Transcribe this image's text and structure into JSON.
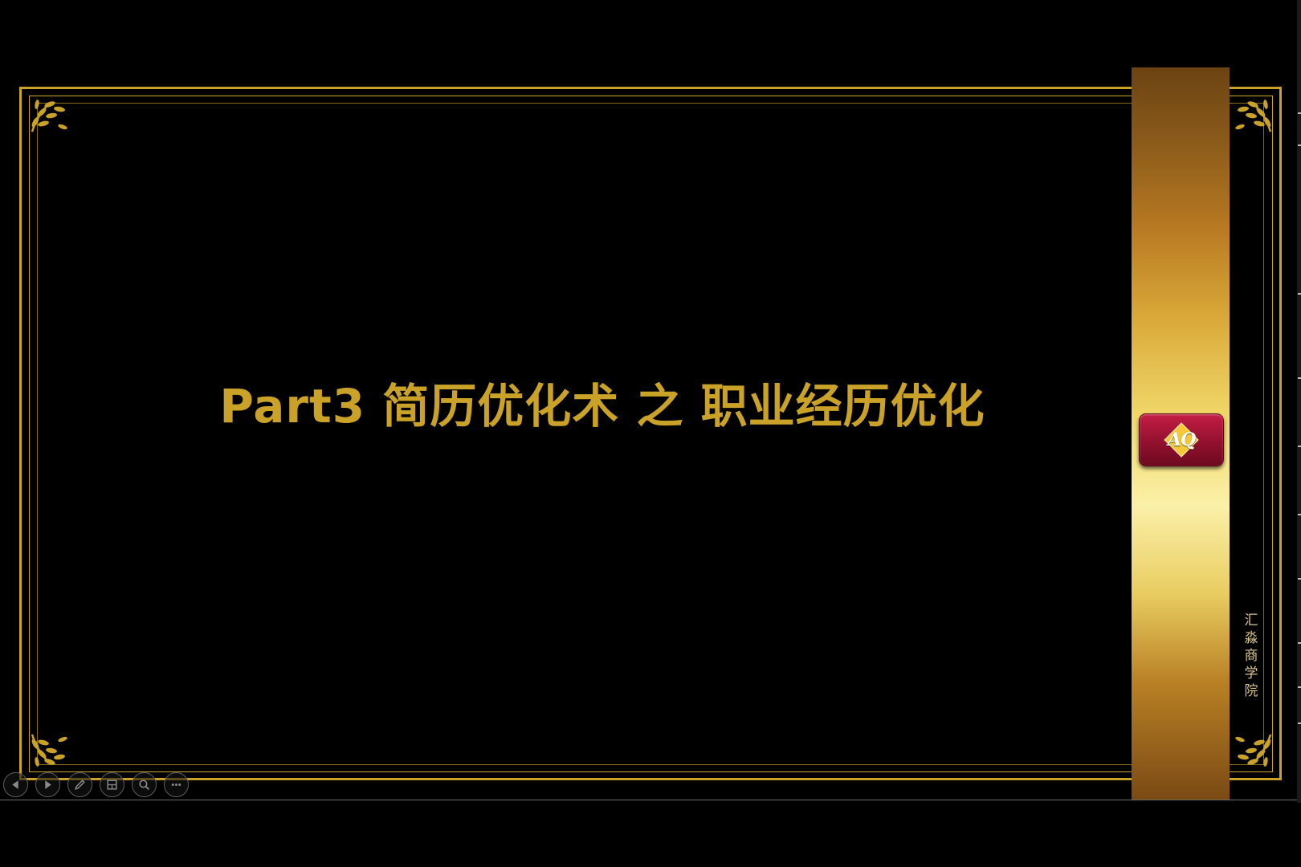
{
  "slide": {
    "title": "Part3 简历优化术 之 职业经历优化",
    "badge_text": "AQ",
    "side_label": "汇淼商学院"
  },
  "colors": {
    "gold": "#c9a227",
    "badge_red": "#a51538",
    "background": "#000000"
  },
  "controls": [
    {
      "name": "previous-slide-button",
      "icon": "arrow-left-icon"
    },
    {
      "name": "next-slide-button",
      "icon": "arrow-right-icon"
    },
    {
      "name": "pen-tool-button",
      "icon": "pen-icon"
    },
    {
      "name": "see-all-slides-button",
      "icon": "slides-grid-icon"
    },
    {
      "name": "zoom-button",
      "icon": "magnifier-icon"
    },
    {
      "name": "more-options-button",
      "icon": "ellipsis-icon"
    }
  ]
}
